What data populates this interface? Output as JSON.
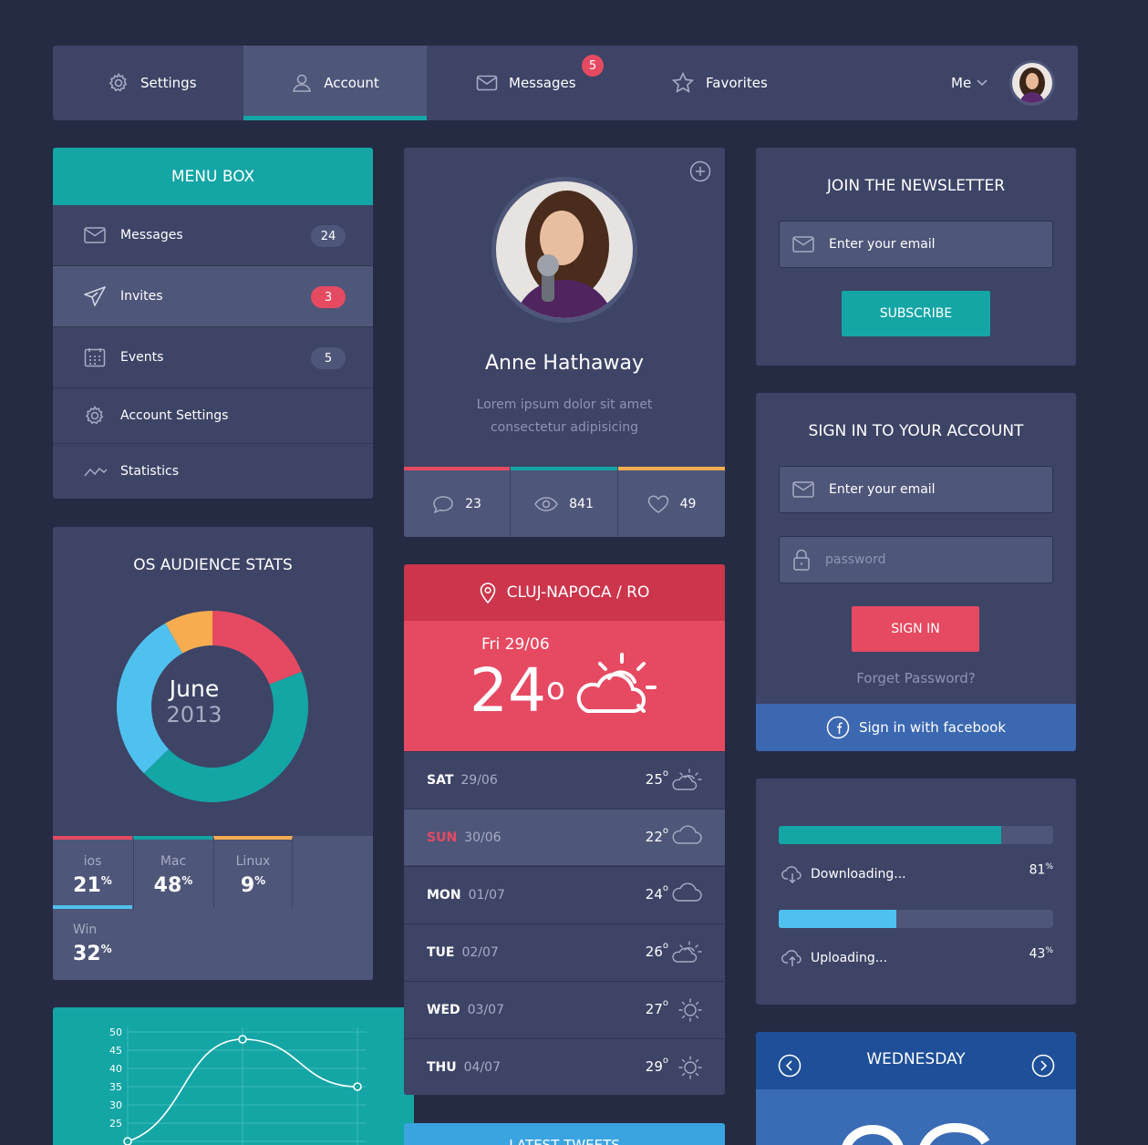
{
  "colors": {
    "bg": "#252b43",
    "panel": "#3d4466",
    "panel_light": "#4e5679",
    "teal": "#14a5a5",
    "red": "#e64a62",
    "orange": "#f7ad4f",
    "blue": "#4fc1ef",
    "facebook": "#3c68b1"
  },
  "nav": {
    "items": [
      {
        "label": "Settings",
        "icon": "gear-icon"
      },
      {
        "label": "Account",
        "icon": "user-icon"
      },
      {
        "label": "Messages",
        "icon": "envelope-icon",
        "badge": "5"
      },
      {
        "label": "Favorites",
        "icon": "star-icon"
      }
    ],
    "user_label": "Me"
  },
  "menu": {
    "title": "MENU BOX",
    "items": [
      {
        "label": "Messages",
        "count": "24",
        "icon": "envelope-icon"
      },
      {
        "label": "Invites",
        "count": "3",
        "icon": "paper-plane-icon"
      },
      {
        "label": "Events",
        "count": "5",
        "icon": "calendar-icon"
      },
      {
        "label": "Account Settings",
        "icon": "gear-icon"
      },
      {
        "label": "Statistics",
        "icon": "line-chart-icon"
      }
    ]
  },
  "profile": {
    "name": "Anne Hathaway",
    "bio_line1": "Lorem ipsum dolor sit amet",
    "bio_line2": "consectetur adipisicing",
    "stats": [
      {
        "icon": "comment-icon",
        "value": "23"
      },
      {
        "icon": "eye-icon",
        "value": "841"
      },
      {
        "icon": "heart-icon",
        "value": "49"
      }
    ]
  },
  "newsletter": {
    "title": "JOIN THE NEWSLETTER",
    "email_placeholder": "Enter your email",
    "button": "SUBSCRIBE"
  },
  "signin": {
    "title": "SIGN IN TO YOUR ACCOUNT",
    "email_placeholder": "Enter your email",
    "password_placeholder": "password",
    "button": "SIGN IN",
    "forgot": "Forget Password?",
    "facebook": "Sign in with facebook"
  },
  "os_stats": {
    "title": "OS AUDIENCE STATS",
    "center_month": "June",
    "center_year": "2013",
    "items": [
      {
        "label": "ios",
        "value": "21",
        "unit": "%"
      },
      {
        "label": "Mac",
        "value": "48",
        "unit": "%"
      },
      {
        "label": "Linux",
        "value": "9",
        "unit": "%"
      },
      {
        "label": "Win",
        "value": "32",
        "unit": "%"
      }
    ]
  },
  "weather": {
    "location": "CLUJ-NAPOCA / RO",
    "today_date": "Fri 29/06",
    "today_temp": "24",
    "degree": "o",
    "forecast": [
      {
        "day": "SAT",
        "date": "29/06",
        "temp": "25",
        "icon": "partly-sunny-icon"
      },
      {
        "day": "SUN",
        "date": "30/06",
        "temp": "22",
        "icon": "cloud-icon"
      },
      {
        "day": "MON",
        "date": "01/07",
        "temp": "24",
        "icon": "cloud-icon"
      },
      {
        "day": "TUE",
        "date": "02/07",
        "temp": "26",
        "icon": "partly-sunny-icon"
      },
      {
        "day": "WED",
        "date": "03/07",
        "temp": "27",
        "icon": "sun-icon"
      },
      {
        "day": "THU",
        "date": "04/07",
        "temp": "29",
        "icon": "sun-icon"
      }
    ]
  },
  "progress": {
    "items": [
      {
        "label": "Downloading...",
        "percent": "81",
        "unit": "%",
        "fraction": 0.81,
        "color": "#14a5a5",
        "icon": "cloud-download-icon"
      },
      {
        "label": "Uploading...",
        "percent": "43",
        "unit": "%",
        "fraction": 0.43,
        "color": "#4fc1ef",
        "icon": "cloud-upload-icon"
      }
    ]
  },
  "calendar": {
    "day": "WEDNESDAY"
  },
  "tweets": {
    "title": "LATEST TWEETS"
  },
  "chart_data": {
    "type": "line",
    "yticks": [
      "50",
      "45",
      "40",
      "35",
      "30",
      "25"
    ],
    "ylim": [
      20,
      50
    ],
    "x": [
      0,
      1,
      2
    ],
    "values": [
      20,
      48,
      35
    ],
    "title": "",
    "xlabel": "",
    "ylabel": ""
  }
}
